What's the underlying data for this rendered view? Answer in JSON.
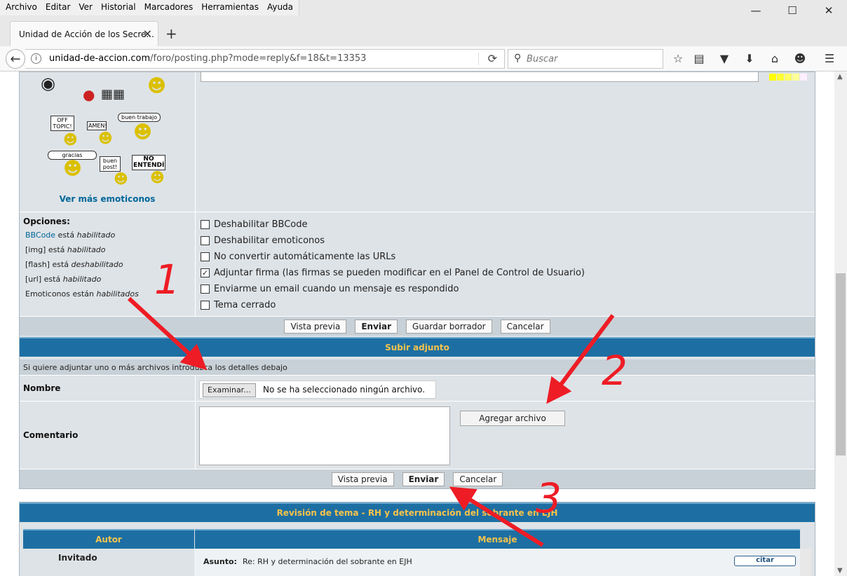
{
  "browser": {
    "menu": [
      "Archivo",
      "Editar",
      "Ver",
      "Historial",
      "Marcadores",
      "Herramientas",
      "Ayuda"
    ],
    "tab_title": "Unidad de Acción de los Secre...",
    "url_domain": "unidad-de-accion.com",
    "url_path": "/foro/posting.php?mode=reply&f=18&t=13353",
    "search_placeholder": "Buscar"
  },
  "smileys": {
    "sign_offtopic": "OFF TOPIC!",
    "sign_amen": "AMEN!",
    "bubble_buen_trabajo": "buen trabajo",
    "bubble_gracias": "gracias",
    "sign_buen_post": "buen post!",
    "sign_no_entendi": "NO ENTENDÍ",
    "more_link": "Ver más emoticonos"
  },
  "options": {
    "title": "Opciones:",
    "bbcode_link": "BBCode",
    "bbcode_state": "habilitado",
    "img_state": "habilitado",
    "flash_state": "deshabilitado",
    "url_state": "habilitado",
    "emoticons_state": "habilitados",
    "checkboxes": [
      {
        "label": "Deshabilitar BBCode",
        "checked": false
      },
      {
        "label": "Deshabilitar emoticonos",
        "checked": false
      },
      {
        "label": "No convertir automáticamente las URLs",
        "checked": false
      },
      {
        "label": "Adjuntar firma (las firmas se pueden modificar en el Panel de Control de Usuario)",
        "checked": true
      },
      {
        "label": "Enviarme un email cuando un mensaje es respondido",
        "checked": false
      },
      {
        "label": "Tema cerrado",
        "checked": false
      }
    ]
  },
  "buttons": {
    "preview": "Vista previa",
    "submit": "Enviar",
    "save_draft": "Guardar borrador",
    "cancel": "Cancelar"
  },
  "attach": {
    "header": "Subir adjunto",
    "info": "Si quiere adjuntar uno o más archivos introduzca los detalles debajo",
    "name_label": "Nombre",
    "browse_label": "Examinar...",
    "no_file": "No se ha seleccionado ningún archivo.",
    "comment_label": "Comentario",
    "add_file": "Agregar archivo"
  },
  "review": {
    "header": "Revisión de tema - RH y determinación del sobrante en EJH",
    "col_author": "Autor",
    "col_message": "Mensaje",
    "author": "Invitado",
    "subject_label": "Asunto:",
    "subject": "Re: RH y determinación del sobrante en EJH",
    "quote": "citar"
  },
  "annotations": [
    "1",
    "2",
    "3"
  ],
  "colors": {
    "header_bg": "#1d6fa3",
    "header_text": "#f7c34b",
    "panel_bg": "#dee3e7",
    "link": "#006699",
    "annotation": "#ee1c25"
  }
}
